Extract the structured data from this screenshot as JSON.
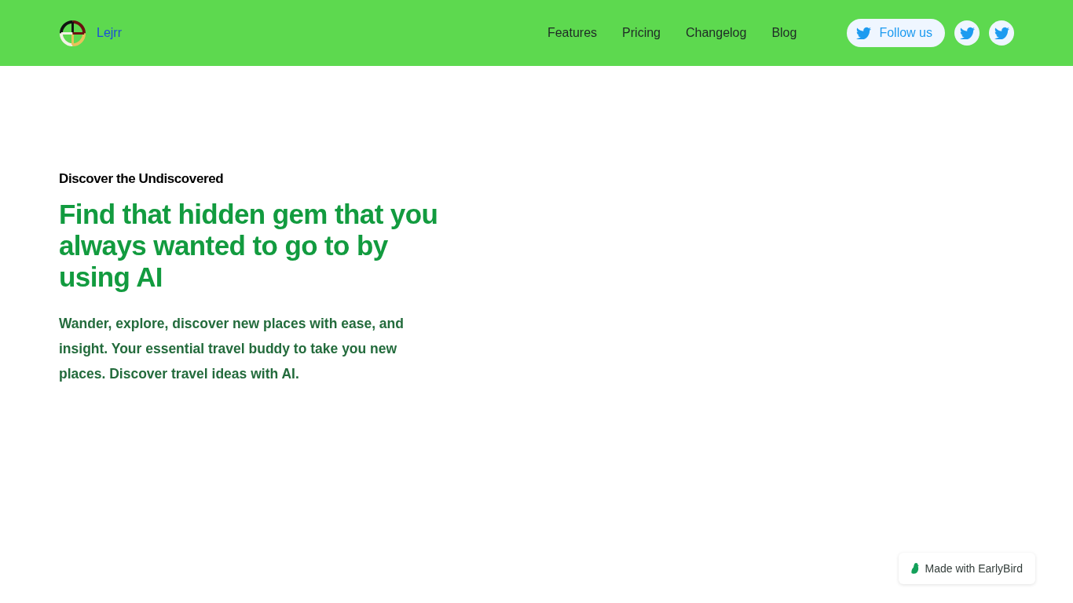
{
  "header": {
    "logo_text": "Lejrr",
    "nav": [
      {
        "label": "Features"
      },
      {
        "label": "Pricing"
      },
      {
        "label": "Changelog"
      },
      {
        "label": "Blog"
      }
    ],
    "follow_button": {
      "label": "Follow us"
    }
  },
  "hero": {
    "eyebrow": "Discover the Undiscovered",
    "headline": "Find that hidden gem that you always wanted to go to by using AI",
    "description": "Wander, explore, discover new places with ease, and insight. Your essential travel buddy to take you new places. Discover travel ideas with AI."
  },
  "badge": {
    "label": "Made with EarlyBird"
  }
}
